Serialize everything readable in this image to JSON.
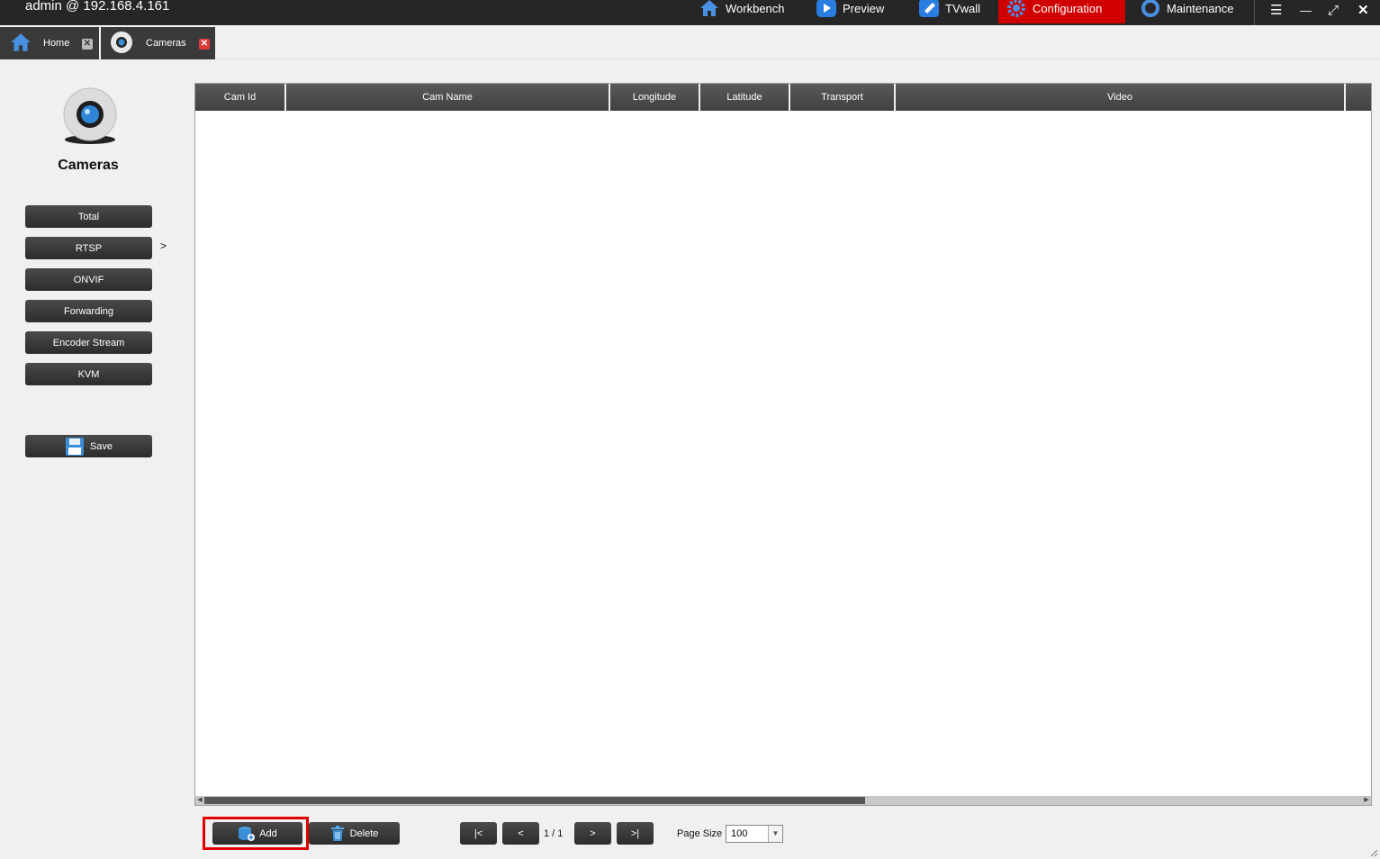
{
  "window": {
    "user_host": "admin @ 192.168.4.161"
  },
  "nav": [
    {
      "label": "Workbench",
      "icon": "home-icon"
    },
    {
      "label": "Preview",
      "icon": "play-icon"
    },
    {
      "label": "TVwall",
      "icon": "wrench-icon"
    },
    {
      "label": "Configuration",
      "icon": "gear-icon",
      "active": true
    },
    {
      "label": "Maintenance",
      "icon": "ring-icon"
    }
  ],
  "window_controls": {
    "menu": "☰",
    "minimize": "—",
    "maximize": "⤢",
    "close": "✕"
  },
  "tabs": [
    {
      "label": "Home",
      "icon": "home-icon"
    },
    {
      "label": "Cameras",
      "icon": "webcam-icon"
    }
  ],
  "sidebar": {
    "title": "Cameras",
    "items": [
      {
        "label": "Total"
      },
      {
        "label": "RTSP"
      },
      {
        "label": "ONVIF"
      },
      {
        "label": "Forwarding"
      },
      {
        "label": "Encoder Stream"
      },
      {
        "label": "KVM"
      }
    ],
    "selected_marker": ">",
    "save_label": "Save"
  },
  "table": {
    "columns": [
      "Cam Id",
      "Cam Name",
      "Longitude",
      "Latitude",
      "Transport",
      "Video"
    ],
    "rows": []
  },
  "toolbar": {
    "add_label": "Add",
    "delete_label": "Delete",
    "first_label": "|<",
    "prev_label": "<",
    "page_info": "1 / 1",
    "next_label": ">",
    "last_label": ">|",
    "page_size_label": "Page Size",
    "page_size_value": "100"
  },
  "colors": {
    "topbar": "#262626",
    "active_nav": "#d00000",
    "highlight": "#e00000",
    "button": "#333333"
  }
}
